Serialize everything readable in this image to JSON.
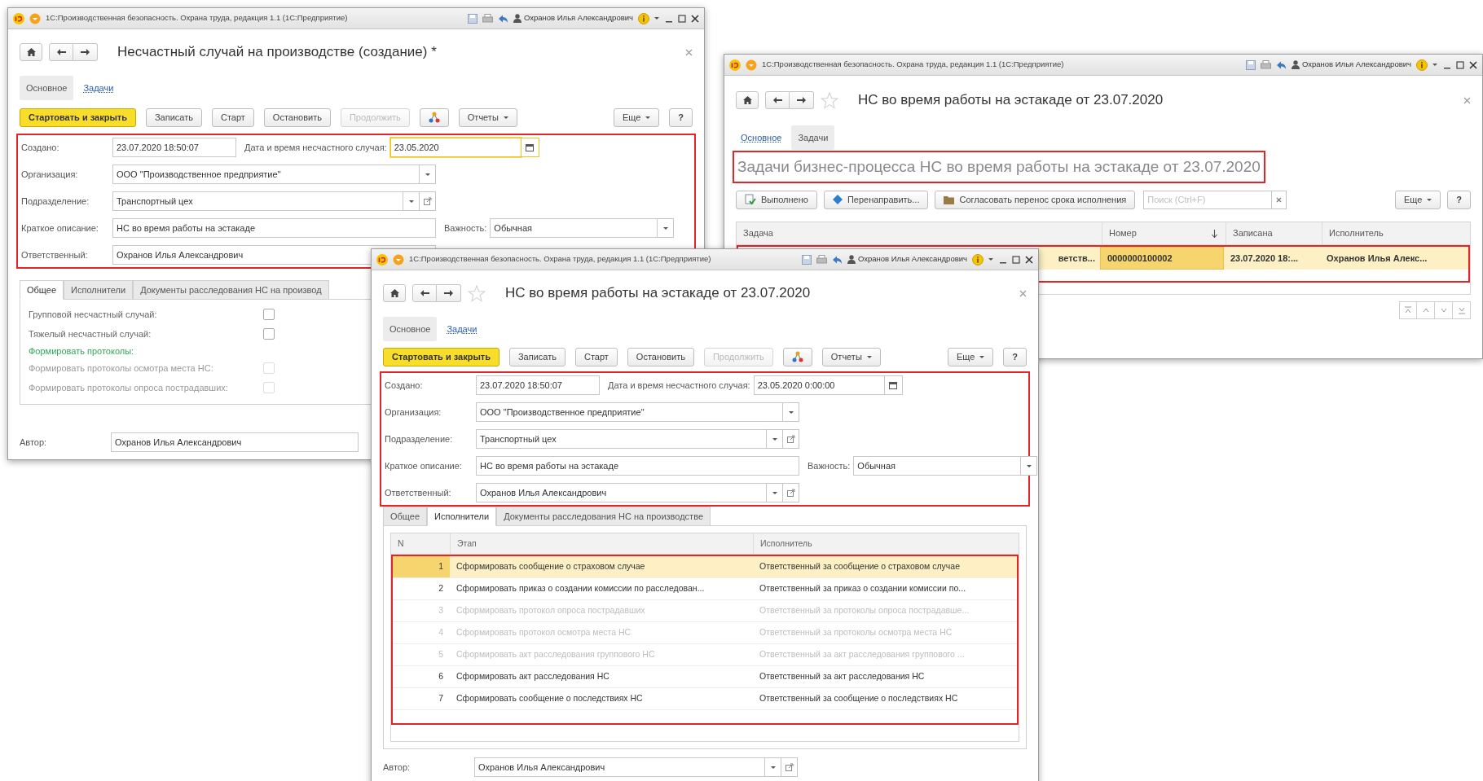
{
  "windows": [
    {
      "kind": "form",
      "title_bar": {
        "text": "1С:Производственная безопасность. Охрана труда, редакция 1.1  (1С:Предприятие)",
        "user": "Охранов Илья Александрович"
      },
      "title": "Несчастный случай на производстве (создание) *",
      "sections": [
        {
          "label": "Основное",
          "selected": true
        },
        {
          "label": "Задачи",
          "selected": false
        }
      ],
      "toolbar": [
        {
          "kind": "primary",
          "label": "Стартовать и закрыть"
        },
        {
          "kind": "button",
          "label": "Записать"
        },
        {
          "kind": "button",
          "label": "Старт"
        },
        {
          "kind": "button",
          "label": "Остановить"
        },
        {
          "kind": "disabled",
          "label": "Продолжить"
        },
        {
          "kind": "diagram"
        },
        {
          "kind": "menu",
          "label": "Отчеты"
        }
      ],
      "toolbar_right": [
        {
          "kind": "menu",
          "label": "Еще"
        },
        {
          "kind": "button",
          "label": "?"
        }
      ],
      "fields": {
        "highlighted": true,
        "rows": [
          [
            {
              "label": "Создано:",
              "value": "23.07.2020 18:50:07"
            },
            {
              "label": "Дата и время несчастного случая:",
              "value": "23.05.2020",
              "focused": true,
              "calendar": true
            }
          ],
          [
            {
              "label": "Организация:",
              "value": "ООО \"Производственное предприятие\"",
              "dropdown": true
            }
          ],
          [
            {
              "label": "Подразделение:",
              "value": "Транспортный цех",
              "dropdown": true,
              "open_button": true
            }
          ],
          [
            {
              "label": "Краткое описание:",
              "value": "НС во время работы на эстакаде"
            },
            {
              "label": "Важность:",
              "value": "Обычная",
              "dropdown": true
            }
          ],
          [
            {
              "label": "Ответственный:",
              "value": "Охранов Илья Александрович"
            }
          ]
        ]
      },
      "tabs": [
        {
          "label": "Общее",
          "selected": true
        },
        {
          "label": "Исполнители",
          "selected": false
        },
        {
          "label": "Документы расследования НС на производ",
          "selected": false
        }
      ],
      "tab_content": {
        "kind": "checkboxes",
        "items": [
          {
            "kind": "checkbox",
            "label": "Групповой несчастный случай:",
            "checked": false,
            "disabled": false
          },
          {
            "kind": "checkbox",
            "label": "Тяжелый несчастный случай:",
            "checked": false,
            "disabled": false
          },
          {
            "kind": "heading",
            "label": "Формировать протоколы:"
          },
          {
            "kind": "checkbox",
            "label": "Формировать протоколы осмотра места НС:",
            "checked": false,
            "disabled": true
          },
          {
            "kind": "checkbox",
            "label": "Формировать протоколы опроса пострадавших:",
            "checked": false,
            "disabled": true
          }
        ]
      },
      "author": {
        "label": "Автор:",
        "value": "Охранов Илья Александрович"
      }
    },
    {
      "kind": "list",
      "title_bar": {
        "text": "1С:Производственная безопасность. Охрана труда, редакция 1.1  (1С:Предприятие)",
        "user": "Охранов Илья Александрович"
      },
      "title": "НС во время работы на эстакаде от 23.07.2020",
      "star": true,
      "sections": [
        {
          "label": "Основное",
          "selected": false
        },
        {
          "label": "Задачи",
          "selected": true
        }
      ],
      "caption": {
        "text": "Задачи бизнес-процесса НС во время работы на эстакаде от 23.07.2020",
        "highlighted": true
      },
      "toolbar": [
        {
          "kind": "action",
          "label": "Выполнено"
        },
        {
          "kind": "action",
          "label": "Перенаправить..."
        },
        {
          "kind": "action",
          "label": "Согласовать перенос срока исполнения"
        }
      ],
      "search": {
        "placeholder": "Поиск (Ctrl+F)"
      },
      "toolbar_right": [
        {
          "kind": "menu",
          "label": "Еще"
        },
        {
          "kind": "button",
          "label": "?"
        }
      ],
      "table": {
        "highlighted": true,
        "columns": [
          {
            "label": "Задача"
          },
          {
            "label": "Номер",
            "sorted": true
          },
          {
            "label": "Записана"
          },
          {
            "label": "Исполнитель"
          }
        ],
        "rows": [
          {
            "cells": [
              "ветств...",
              "0000000100002",
              "23.07.2020 18:...",
              "Охранов Илья Алекс..."
            ],
            "selected": true
          }
        ]
      }
    },
    {
      "kind": "form",
      "title_bar": {
        "text": "1С:Производственная безопасность. Охрана труда, редакция 1.1  (1С:Предприятие)",
        "user": "Охранов Илья Александрович"
      },
      "title": "НС во время работы на эстакаде от 23.07.2020",
      "star": true,
      "sections": [
        {
          "label": "Основное",
          "selected": true
        },
        {
          "label": "Задачи",
          "selected": false
        }
      ],
      "toolbar": [
        {
          "kind": "primary",
          "label": "Стартовать и закрыть"
        },
        {
          "kind": "button",
          "label": "Записать"
        },
        {
          "kind": "button",
          "label": "Старт"
        },
        {
          "kind": "button",
          "label": "Остановить"
        },
        {
          "kind": "disabled",
          "label": "Продолжить"
        },
        {
          "kind": "diagram"
        },
        {
          "kind": "menu",
          "label": "Отчеты"
        }
      ],
      "toolbar_right": [
        {
          "kind": "menu",
          "label": "Еще"
        },
        {
          "kind": "button",
          "label": "?"
        }
      ],
      "fields": {
        "highlighted": true,
        "rows": [
          [
            {
              "label": "Создано:",
              "value": "23.07.2020 18:50:07"
            },
            {
              "label": "Дата и время несчастного случая:",
              "value": "23.05.2020  0:00:00",
              "calendar": true
            }
          ],
          [
            {
              "label": "Организация:",
              "value": "ООО \"Производственное предприятие\"",
              "dropdown": true
            }
          ],
          [
            {
              "label": "Подразделение:",
              "value": "Транспортный цех",
              "dropdown": true,
              "open_button": true
            }
          ],
          [
            {
              "label": "Краткое описание:",
              "value": "НС во время работы на эстакаде"
            },
            {
              "label": "Важность:",
              "value": "Обычная",
              "dropdown": true
            }
          ],
          [
            {
              "label": "Ответственный:",
              "value": "Охранов Илья Александрович",
              "dropdown": true,
              "open_button": true
            }
          ]
        ]
      },
      "tabs": [
        {
          "label": "Общее",
          "selected": false
        },
        {
          "label": "Исполнители",
          "selected": true
        },
        {
          "label": "Документы расследования НС на производстве",
          "selected": false
        }
      ],
      "tab_content": {
        "kind": "table",
        "highlighted": true,
        "columns": [
          "N",
          "Этап",
          "Исполнитель"
        ],
        "rows": [
          {
            "n": "1",
            "stage": "Сформировать сообщение о страховом случае",
            "executor": "Ответственный за сообщение о страховом случае",
            "selected": true,
            "disabled": false
          },
          {
            "n": "2",
            "stage": "Сформировать приказ о создании комиссии по расследован...",
            "executor": "Ответственный за приказ о создании комиссии по...",
            "selected": false,
            "disabled": false
          },
          {
            "n": "3",
            "stage": "Сформировать протокол опроса пострадавших",
            "executor": "Ответственный за протоколы опроса пострадавше...",
            "selected": false,
            "disabled": true
          },
          {
            "n": "4",
            "stage": "Сформировать протокол осмотра места НС",
            "executor": "Ответственный за протоколы осмотра места НС",
            "selected": false,
            "disabled": true
          },
          {
            "n": "5",
            "stage": "Сформировать акт расследования группового НС",
            "executor": "Ответственный за акт расследования группового ...",
            "selected": false,
            "disabled": true
          },
          {
            "n": "6",
            "stage": "Сформировать акт расследования НС",
            "executor": "Ответственный за акт расследования НС",
            "selected": false,
            "disabled": false
          },
          {
            "n": "7",
            "stage": "Сформировать сообщение о последствиях НС",
            "executor": "Ответственный за сообщение о последствиях НС",
            "selected": false,
            "disabled": false
          }
        ]
      },
      "author": {
        "label": "Автор:",
        "value": "Охранов Илья Александрович",
        "dropdown": true,
        "open_button": true
      }
    }
  ]
}
